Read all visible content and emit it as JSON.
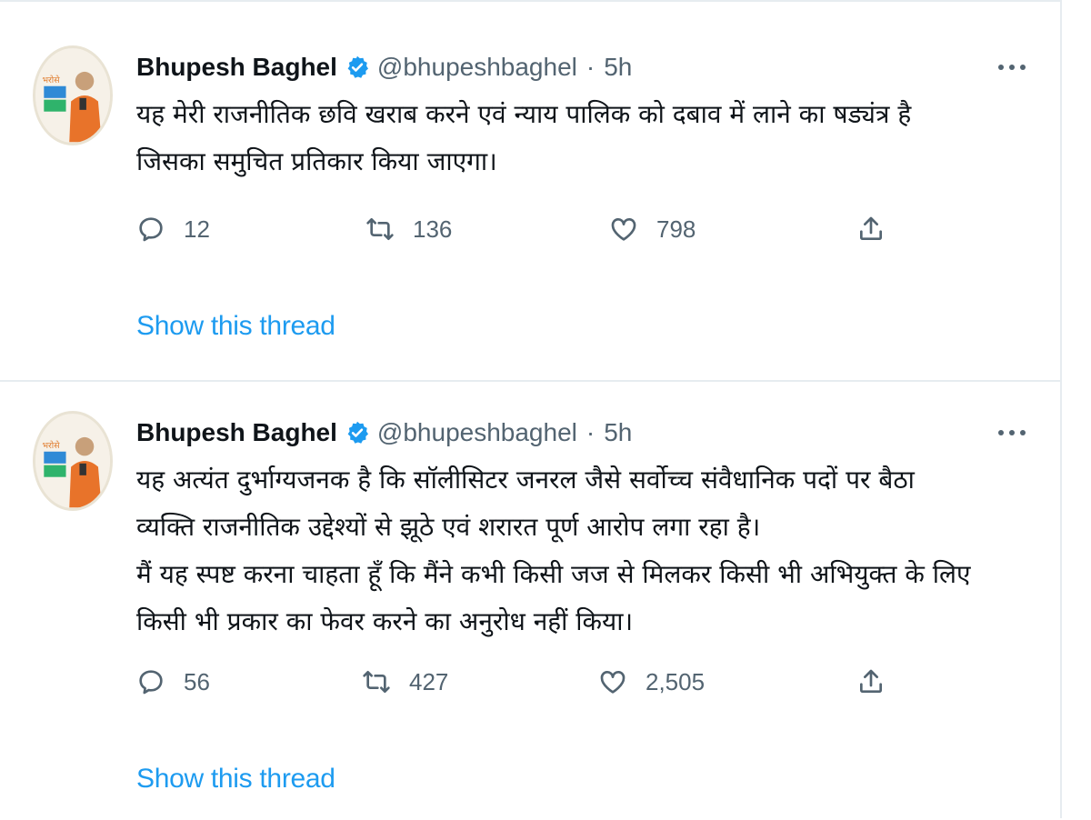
{
  "tweets": [
    {
      "author": {
        "name": "Bhupesh Baghel",
        "handle": "@bhupeshbaghel",
        "separator": "·",
        "time": "5h"
      },
      "text_lines": [
        "यह मेरी राजनीतिक छवि खराब करने एवं न्याय पालिक को दबाव में लाने का षड्यंत्र है",
        "जिसका समुचित प्रतिकार किया जाएगा।"
      ],
      "replies": "12",
      "retweets": "136",
      "likes": "798",
      "thread_link": "Show this thread"
    },
    {
      "author": {
        "name": "Bhupesh Baghel",
        "handle": "@bhupeshbaghel",
        "separator": "·",
        "time": "5h"
      },
      "text_lines": [
        "यह अत्यंत दुर्भाग्यजनक है कि सॉलीसिटर जनरल जैसे सर्वोच्च संवैधानिक पदों पर बैठा",
        "व्यक्ति राजनीतिक उद्देश्यों से झूठे एवं शरारत पूर्ण आरोप लगा रहा है।",
        "मैं यह स्पष्ट करना चाहता हूँ कि मैंने कभी किसी जज से मिलकर किसी भी अभियुक्त के लिए",
        "किसी भी प्रकार का फेवर करने का अनुरोध नहीं किया।"
      ],
      "replies": "56",
      "retweets": "427",
      "likes": "2,505",
      "thread_link": "Show this thread"
    }
  ],
  "icons": {
    "verified": "verified-badge-icon",
    "more": "more-dots-icon",
    "reply": "reply-bubble-icon",
    "retweet": "retweet-icon",
    "like": "heart-icon",
    "share": "share-upload-icon"
  },
  "colors": {
    "link": "#1d9bf0",
    "verified": "#1d9bf0",
    "muted": "#536471",
    "text": "#0f1419",
    "border": "#e6ecf0"
  }
}
